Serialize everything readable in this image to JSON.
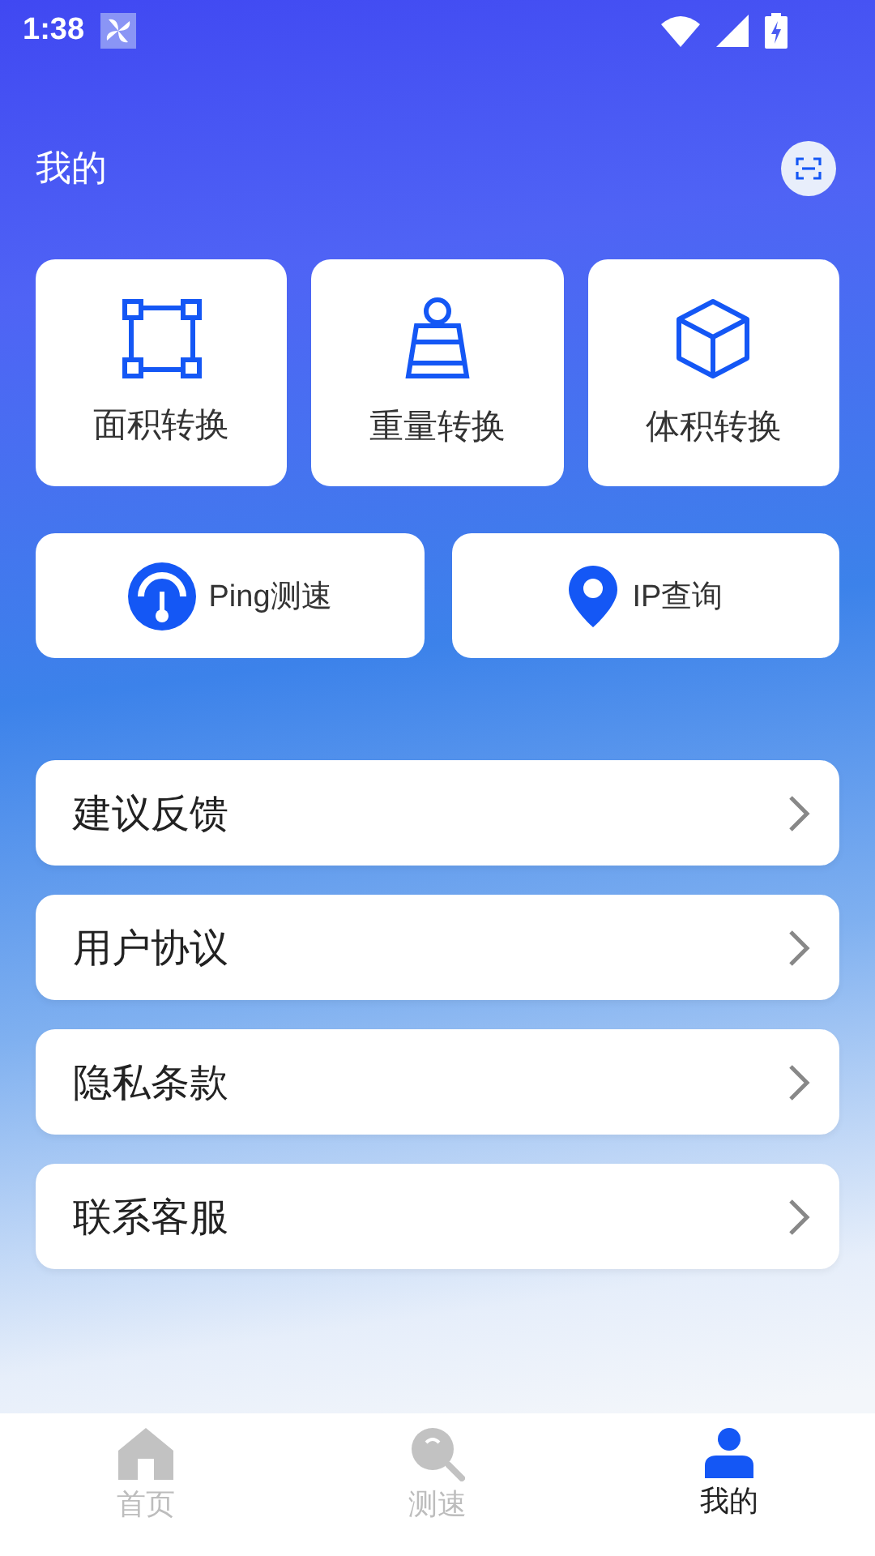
{
  "status_bar": {
    "time": "1:38"
  },
  "header": {
    "title": "我的"
  },
  "tools": [
    {
      "label": "面积转换",
      "kind": "area"
    },
    {
      "label": "重量转换",
      "kind": "weight"
    },
    {
      "label": "体积转换",
      "kind": "volume"
    }
  ],
  "quick_actions": [
    {
      "label": "Ping测速",
      "kind": "gauge"
    },
    {
      "label": "IP查询",
      "kind": "pin"
    }
  ],
  "menu": [
    {
      "label": "建议反馈"
    },
    {
      "label": "用户协议"
    },
    {
      "label": "隐私条款"
    },
    {
      "label": "联系客服"
    }
  ],
  "bottom_nav": [
    {
      "label": "首页",
      "kind": "home",
      "selected": false
    },
    {
      "label": "测速",
      "kind": "search",
      "selected": false
    },
    {
      "label": "我的",
      "kind": "user",
      "selected": true
    }
  ]
}
